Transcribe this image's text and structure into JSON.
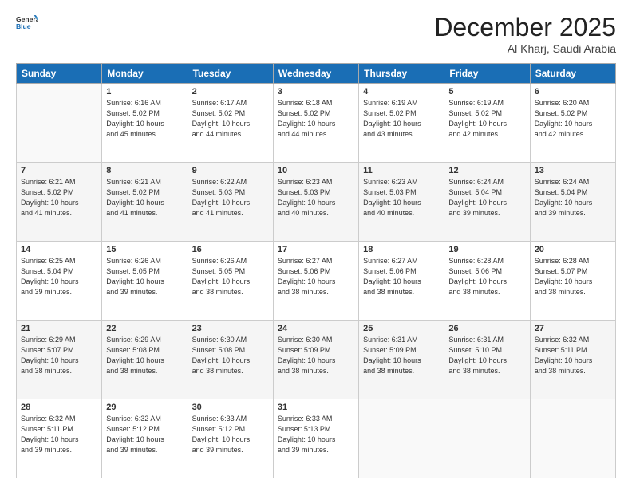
{
  "header": {
    "logo_general": "General",
    "logo_blue": "Blue",
    "month": "December 2025",
    "location": "Al Kharj, Saudi Arabia"
  },
  "weekdays": [
    "Sunday",
    "Monday",
    "Tuesday",
    "Wednesday",
    "Thursday",
    "Friday",
    "Saturday"
  ],
  "weeks": [
    [
      {
        "day": "",
        "empty": true
      },
      {
        "day": "1",
        "sunrise": "6:16 AM",
        "sunset": "5:02 PM",
        "daylight": "10 hours and 45 minutes."
      },
      {
        "day": "2",
        "sunrise": "6:17 AM",
        "sunset": "5:02 PM",
        "daylight": "10 hours and 44 minutes."
      },
      {
        "day": "3",
        "sunrise": "6:18 AM",
        "sunset": "5:02 PM",
        "daylight": "10 hours and 44 minutes."
      },
      {
        "day": "4",
        "sunrise": "6:19 AM",
        "sunset": "5:02 PM",
        "daylight": "10 hours and 43 minutes."
      },
      {
        "day": "5",
        "sunrise": "6:19 AM",
        "sunset": "5:02 PM",
        "daylight": "10 hours and 42 minutes."
      },
      {
        "day": "6",
        "sunrise": "6:20 AM",
        "sunset": "5:02 PM",
        "daylight": "10 hours and 42 minutes."
      }
    ],
    [
      {
        "day": "7",
        "sunrise": "6:21 AM",
        "sunset": "5:02 PM",
        "daylight": "10 hours and 41 minutes."
      },
      {
        "day": "8",
        "sunrise": "6:21 AM",
        "sunset": "5:02 PM",
        "daylight": "10 hours and 41 minutes."
      },
      {
        "day": "9",
        "sunrise": "6:22 AM",
        "sunset": "5:03 PM",
        "daylight": "10 hours and 41 minutes."
      },
      {
        "day": "10",
        "sunrise": "6:23 AM",
        "sunset": "5:03 PM",
        "daylight": "10 hours and 40 minutes."
      },
      {
        "day": "11",
        "sunrise": "6:23 AM",
        "sunset": "5:03 PM",
        "daylight": "10 hours and 40 minutes."
      },
      {
        "day": "12",
        "sunrise": "6:24 AM",
        "sunset": "5:04 PM",
        "daylight": "10 hours and 39 minutes."
      },
      {
        "day": "13",
        "sunrise": "6:24 AM",
        "sunset": "5:04 PM",
        "daylight": "10 hours and 39 minutes."
      }
    ],
    [
      {
        "day": "14",
        "sunrise": "6:25 AM",
        "sunset": "5:04 PM",
        "daylight": "10 hours and 39 minutes."
      },
      {
        "day": "15",
        "sunrise": "6:26 AM",
        "sunset": "5:05 PM",
        "daylight": "10 hours and 39 minutes."
      },
      {
        "day": "16",
        "sunrise": "6:26 AM",
        "sunset": "5:05 PM",
        "daylight": "10 hours and 38 minutes."
      },
      {
        "day": "17",
        "sunrise": "6:27 AM",
        "sunset": "5:06 PM",
        "daylight": "10 hours and 38 minutes."
      },
      {
        "day": "18",
        "sunrise": "6:27 AM",
        "sunset": "5:06 PM",
        "daylight": "10 hours and 38 minutes."
      },
      {
        "day": "19",
        "sunrise": "6:28 AM",
        "sunset": "5:06 PM",
        "daylight": "10 hours and 38 minutes."
      },
      {
        "day": "20",
        "sunrise": "6:28 AM",
        "sunset": "5:07 PM",
        "daylight": "10 hours and 38 minutes."
      }
    ],
    [
      {
        "day": "21",
        "sunrise": "6:29 AM",
        "sunset": "5:07 PM",
        "daylight": "10 hours and 38 minutes."
      },
      {
        "day": "22",
        "sunrise": "6:29 AM",
        "sunset": "5:08 PM",
        "daylight": "10 hours and 38 minutes."
      },
      {
        "day": "23",
        "sunrise": "6:30 AM",
        "sunset": "5:08 PM",
        "daylight": "10 hours and 38 minutes."
      },
      {
        "day": "24",
        "sunrise": "6:30 AM",
        "sunset": "5:09 PM",
        "daylight": "10 hours and 38 minutes."
      },
      {
        "day": "25",
        "sunrise": "6:31 AM",
        "sunset": "5:09 PM",
        "daylight": "10 hours and 38 minutes."
      },
      {
        "day": "26",
        "sunrise": "6:31 AM",
        "sunset": "5:10 PM",
        "daylight": "10 hours and 38 minutes."
      },
      {
        "day": "27",
        "sunrise": "6:32 AM",
        "sunset": "5:11 PM",
        "daylight": "10 hours and 38 minutes."
      }
    ],
    [
      {
        "day": "28",
        "sunrise": "6:32 AM",
        "sunset": "5:11 PM",
        "daylight": "10 hours and 39 minutes."
      },
      {
        "day": "29",
        "sunrise": "6:32 AM",
        "sunset": "5:12 PM",
        "daylight": "10 hours and 39 minutes."
      },
      {
        "day": "30",
        "sunrise": "6:33 AM",
        "sunset": "5:12 PM",
        "daylight": "10 hours and 39 minutes."
      },
      {
        "day": "31",
        "sunrise": "6:33 AM",
        "sunset": "5:13 PM",
        "daylight": "10 hours and 39 minutes."
      },
      {
        "day": "",
        "empty": true
      },
      {
        "day": "",
        "empty": true
      },
      {
        "day": "",
        "empty": true
      }
    ]
  ]
}
